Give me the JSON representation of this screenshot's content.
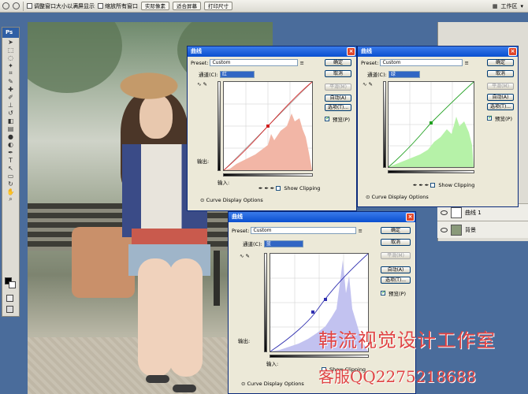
{
  "options_bar": {
    "resize_windows": "调整窗口大小以满屏显示",
    "zoom_all": "缩放所有窗口",
    "actual_pixels": "实际像素",
    "fit_screen": "适合屏幕",
    "print_size": "打印尺寸",
    "workspace": "工作区"
  },
  "toolbox": {
    "logo": "Ps"
  },
  "layers": {
    "layer1": "曲线 1",
    "background": "背景"
  },
  "curves_red_top": {
    "title": "曲线",
    "preset_label": "Preset:",
    "preset_value": "Custom",
    "channel_label": "通道(C):",
    "channel_value": "红",
    "output_label": "输出:",
    "input_label": "输入:",
    "show_clipping": "Show Clipping",
    "display_options": "Curve Display Options",
    "ok": "确定",
    "cancel": "取消",
    "smooth": "平滑(M)",
    "auto": "自动(A)",
    "options": "选项(T)...",
    "preview": "预览(P)"
  },
  "curves_green": {
    "title": "曲线",
    "preset_label": "Preset:",
    "preset_value": "Custom",
    "channel_label": "通道(C):",
    "channel_value": "绿",
    "show_clipping": "Show Clipping",
    "display_options": "Curve Display Options",
    "ok": "确定",
    "cancel": "取消",
    "smooth": "平滑(M)",
    "auto": "自动(A)",
    "options": "选项(T)...",
    "preview": "预览(P)"
  },
  "curves_blue": {
    "title": "曲线",
    "preset_label": "Preset:",
    "preset_value": "Custom",
    "channel_label": "通道(C):",
    "channel_value": "蓝",
    "output_label": "输出:",
    "input_label": "输入:",
    "show_clipping": "Show Clipping",
    "display_options": "Curve Display Options",
    "ok": "确定",
    "cancel": "取消",
    "smooth": "平滑(M)",
    "auto": "自动(A)",
    "options": "选项(T)...",
    "preview": "预览(P)"
  },
  "watermark": {
    "studio": "韩流视觉设计工作室",
    "service": "客服QQ2275218688"
  },
  "colors": {
    "red_hist": "#f2b6a6",
    "green_hist": "#b6f2a8",
    "blue_hist": "#c2c2f0",
    "watermark": "#e04444"
  }
}
